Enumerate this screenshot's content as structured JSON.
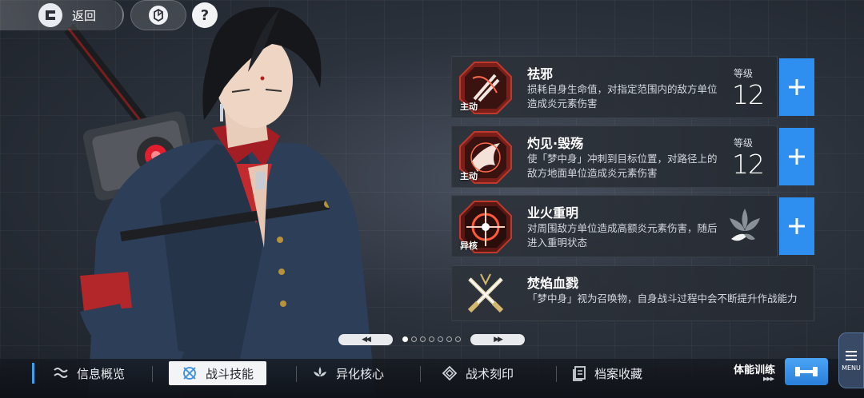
{
  "topbar": {
    "back_label": "返回",
    "help_label": "?"
  },
  "skills": [
    {
      "name": "祛邪",
      "tag": "主动",
      "desc": "损耗自身生命值，对指定范围内的敌方单位造成炎元素伤害",
      "level_label": "等级",
      "level": "12"
    },
    {
      "name": "灼见·毁殇",
      "tag": "主动",
      "desc": "使「梦中身」冲刺到目标位置，对路径上的敌方地面单位造成炎元素伤害",
      "level_label": "等级",
      "level": "12"
    },
    {
      "name": "业火重明",
      "tag": "异核",
      "desc": "对周围敌方单位造成高额炎元素伤害，随后进入重明状态"
    }
  ],
  "passive": {
    "name": "焚焰血戮",
    "desc": "「梦中身」视为召唤物，自身战斗过程中会不断提升作战能力"
  },
  "pager": {
    "prev": "◀◀",
    "next": "▶▶",
    "dots": 7,
    "active": 0
  },
  "bottom_nav": [
    {
      "label": "信息概览",
      "icon": "wave-icon"
    },
    {
      "label": "战斗技能",
      "icon": "crossed-circle-icon",
      "active": true
    },
    {
      "label": "异化核心",
      "icon": "leaf-core-icon"
    },
    {
      "label": "战术刻印",
      "icon": "diamond-frame-icon"
    },
    {
      "label": "档案收藏",
      "icon": "file-icon"
    }
  ],
  "training": {
    "label": "体能训练",
    "arrows": "▶▶▶"
  },
  "menu": {
    "label": "MENU"
  },
  "colors": {
    "accent_blue": "#2f8ff0",
    "skill_red": "#c0382b"
  }
}
